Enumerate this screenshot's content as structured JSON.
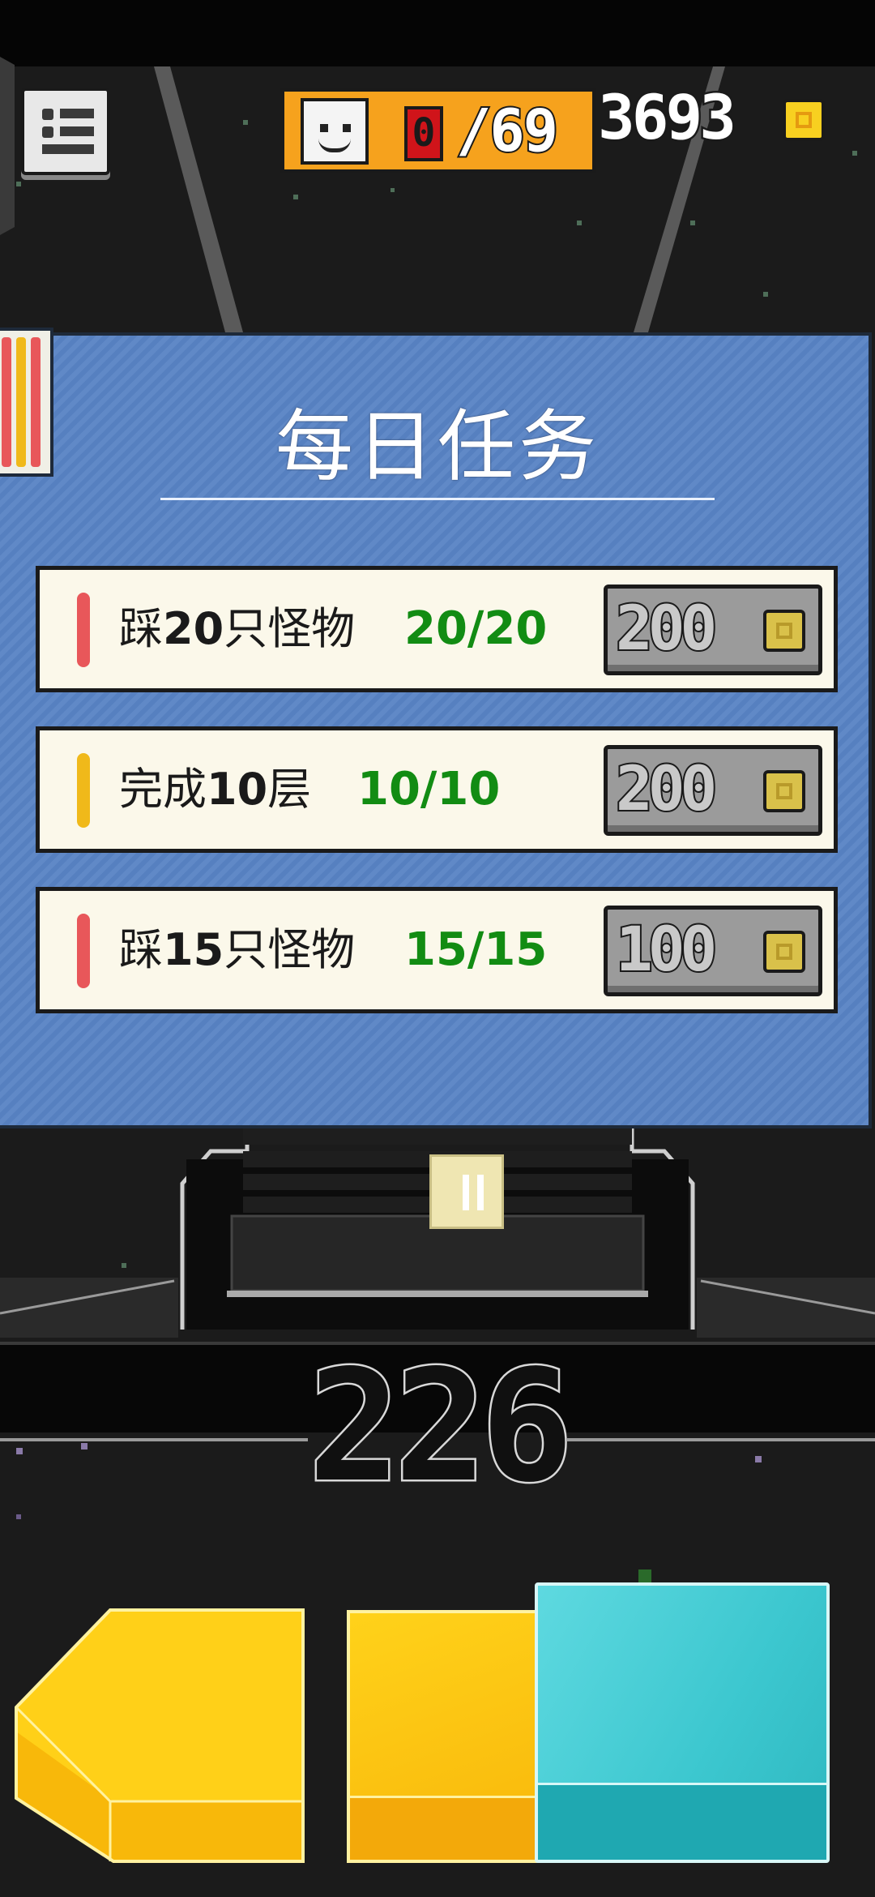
{
  "top_bar": {
    "menu_icon": "menu-list-icon",
    "monsters_found": "0",
    "monsters_total": "/69",
    "coins": "3693",
    "coin_icon": "coin-icon"
  },
  "panel": {
    "title": "每日任务",
    "accent_colors": {
      "red": "#e8575a",
      "yellow": "#f0b91a",
      "green": "#128c13"
    },
    "quests": [
      {
        "prefix": "踩",
        "number": "20",
        "suffix": "只怪物",
        "progress": "20/20",
        "reward": "200",
        "marker_color": "#e8575a"
      },
      {
        "prefix": "完成",
        "number": "10",
        "suffix": "层",
        "progress": "10/10",
        "reward": "200",
        "marker_color": "#f0b91a"
      },
      {
        "prefix": "踩",
        "number": "15",
        "suffix": "只怪物",
        "progress": "15/15",
        "reward": "100",
        "marker_color": "#e8575a"
      }
    ]
  },
  "game": {
    "floor_number": "226"
  },
  "controls": {
    "left_button_icon": "left-arrow-block-icon",
    "jump_button_icon": "yellow-block-icon",
    "action_button_icon": "cyan-block-icon"
  }
}
